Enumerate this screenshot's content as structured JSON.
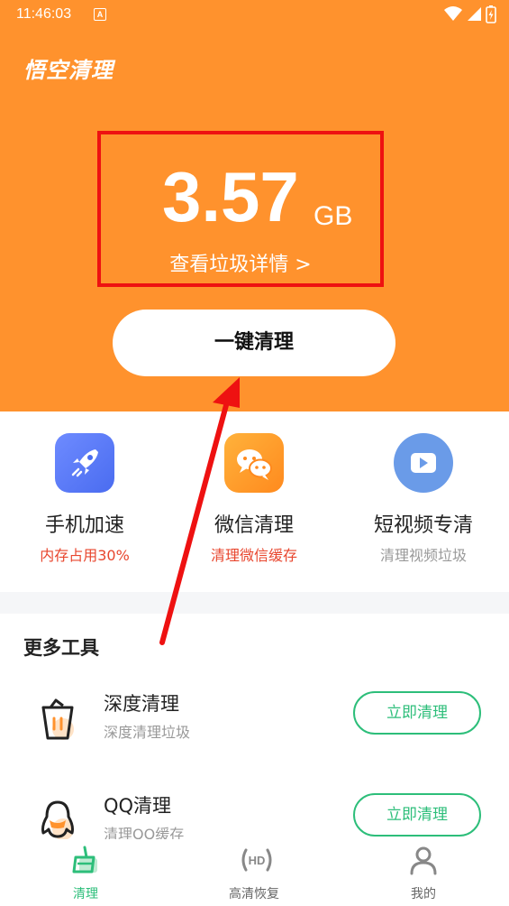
{
  "status_bar": {
    "time": "11:46:03",
    "notification_badge": "A"
  },
  "header": {
    "app_title": "悟空清理"
  },
  "junk": {
    "value": "3.57",
    "unit": "GB",
    "detail_link": "查看垃圾详情 >"
  },
  "clean_button": {
    "label": "一键清理"
  },
  "features": [
    {
      "title": "手机加速",
      "subtitle": "内存占用30%",
      "icon": "rocket-icon"
    },
    {
      "title": "微信清理",
      "subtitle": "清理微信缓存",
      "icon": "wechat-icon"
    },
    {
      "title": "短视频专清",
      "subtitle": "清理视频垃圾",
      "icon": "video-play-icon"
    }
  ],
  "tools": {
    "section_title": "更多工具",
    "items": [
      {
        "name": "深度清理",
        "desc": "深度清理垃圾",
        "button": "立即清理",
        "icon": "trash-bin-icon"
      },
      {
        "name": "QQ清理",
        "desc": "清理QQ缓存",
        "button": "立即清理",
        "icon": "qq-penguin-icon"
      }
    ]
  },
  "bottom_nav": {
    "items": [
      {
        "label": "清理",
        "icon": "broom-icon",
        "active": true
      },
      {
        "label": "高清恢复",
        "icon": "hd-icon",
        "active": false
      },
      {
        "label": "我的",
        "icon": "user-icon",
        "active": false
      }
    ]
  },
  "colors": {
    "brand_orange": "#FF922D",
    "accent_green": "#2DBE7A",
    "highlight_red": "#EE1111",
    "warning_text": "#E8462E",
    "muted_text": "#999999"
  }
}
